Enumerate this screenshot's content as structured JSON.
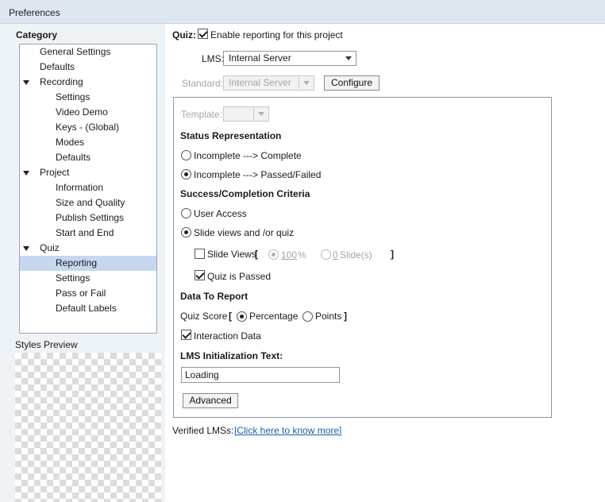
{
  "window": {
    "title": "Preferences"
  },
  "sidebar": {
    "category_label": "Category",
    "items": [
      {
        "label": "General Settings"
      },
      {
        "label": "Defaults"
      },
      {
        "label": "Recording",
        "expanded": true
      },
      {
        "label": "Settings"
      },
      {
        "label": "Video Demo"
      },
      {
        "label": "Keys - (Global)"
      },
      {
        "label": "Modes"
      },
      {
        "label": "Defaults"
      },
      {
        "label": "Project",
        "expanded": true
      },
      {
        "label": "Information"
      },
      {
        "label": "Size and Quality"
      },
      {
        "label": "Publish Settings"
      },
      {
        "label": "Start and End"
      },
      {
        "label": "Quiz",
        "expanded": true
      },
      {
        "label": "Reporting",
        "selected": true
      },
      {
        "label": "Settings"
      },
      {
        "label": "Pass or Fail"
      },
      {
        "label": "Default Labels"
      }
    ],
    "styles_preview_label": "Styles Preview"
  },
  "reporting": {
    "quiz_label": "Quiz:",
    "enable_reporting_label": "Enable reporting for this project",
    "enable_reporting_checked": true,
    "lms_label": "LMS:",
    "lms_value": "Internal Server",
    "standard_label": "Standard:",
    "standard_value": "Internal Server",
    "configure_label": "Configure",
    "template_label": "Template:",
    "template_value": "",
    "status_heading": "Status Representation",
    "status_options": [
      {
        "label": "Incomplete ---> Complete",
        "checked": false
      },
      {
        "label": "Incomplete ---> Passed/Failed",
        "checked": true
      }
    ],
    "success_heading": "Success/Completion Criteria",
    "success_options": [
      {
        "label": "User Access",
        "checked": false
      },
      {
        "label": "Slide views and /or quiz",
        "checked": true
      }
    ],
    "slide_views": {
      "label": "Slide Views",
      "checked": false,
      "open_bracket": "[",
      "close_bracket": "]",
      "percent_value": "100",
      "percent_unit": "%",
      "slides_value": "0",
      "slides_unit": "Slide(s)"
    },
    "quiz_passed": {
      "label": "Quiz is Passed",
      "checked": true
    },
    "data_heading": "Data To Report",
    "quiz_score": {
      "label": "Quiz Score",
      "open_bracket": "[",
      "close_bracket": "]",
      "percentage_label": "Percentage",
      "percentage_checked": true,
      "points_label": "Points",
      "points_checked": false
    },
    "interaction_data": {
      "label": "Interaction Data",
      "checked": true
    },
    "lms_init_heading": "LMS Initialization Text:",
    "lms_init_value": "Loading",
    "advanced_label": "Advanced",
    "verified_label": "Verified LMSs:",
    "verified_link": "[Click here to know more]"
  }
}
